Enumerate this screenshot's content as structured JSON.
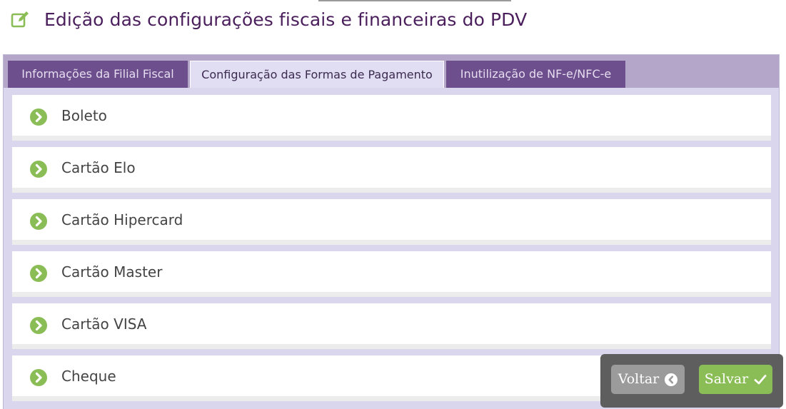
{
  "header": {
    "icon": "edit-icon",
    "title": "Edição das configurações fiscais e financeiras do PDV"
  },
  "tabs": [
    {
      "label": "Informações da Filial Fiscal",
      "active": false
    },
    {
      "label": "Configuração das Formas de Pagamento",
      "active": true
    },
    {
      "label": "Inutilização de NF-e/NFC-e",
      "active": false
    }
  ],
  "payment_methods": [
    {
      "label": "Boleto",
      "icon": "chevron-right-circle-icon"
    },
    {
      "label": "Cartão Elo",
      "icon": "chevron-right-circle-icon"
    },
    {
      "label": "Cartão Hipercard",
      "icon": "chevron-right-circle-icon"
    },
    {
      "label": "Cartão Master",
      "icon": "chevron-right-circle-icon"
    },
    {
      "label": "Cartão VISA",
      "icon": "chevron-right-circle-icon"
    },
    {
      "label": "Cheque",
      "icon": "chevron-right-circle-icon"
    }
  ],
  "actions": {
    "back_label": "Voltar",
    "back_icon": "chevron-left-circle-icon",
    "save_label": "Salvar",
    "save_icon": "check-icon"
  },
  "colors": {
    "title": "#4a1f5c",
    "tab_inactive": "#6c4f8c",
    "tab_active": "#e1def3",
    "accent_green": "#8bbd57",
    "panel_bg": "#d9d6ee"
  }
}
